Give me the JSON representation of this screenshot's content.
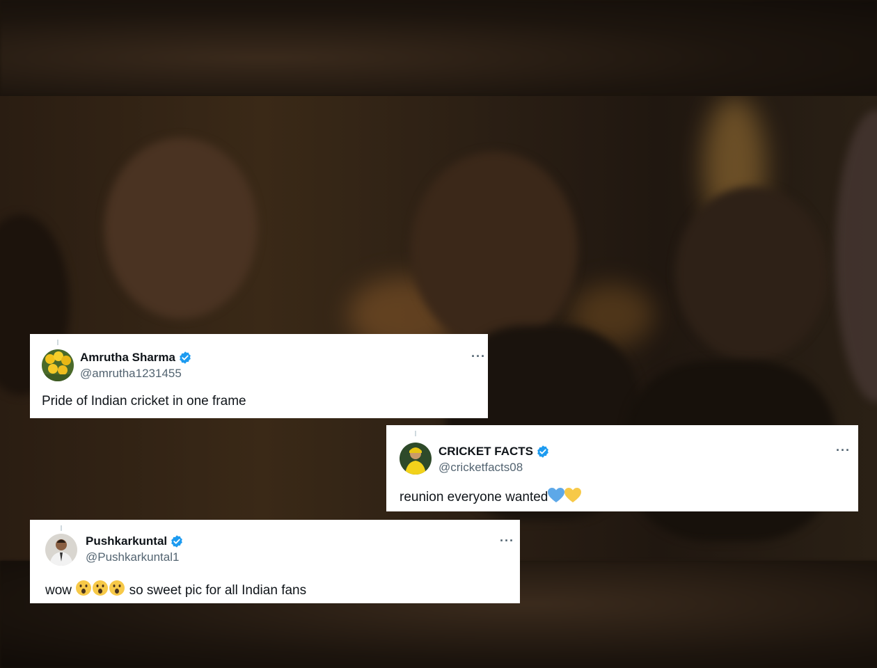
{
  "tweets": [
    {
      "name": "Amrutha Sharma",
      "handle": "@amrutha1231455",
      "text": "Pride of Indian cricket in one frame",
      "avatar_icon": "yellow-tulips-avatar",
      "more_label": "···"
    },
    {
      "name": "CRICKET FACTS",
      "handle": "@cricketfacts08",
      "text": "reunion everyone wanted",
      "emojis": [
        "💙",
        "💛"
      ],
      "avatar_icon": "cricketer-yellow-jersey-avatar",
      "more_label": "···"
    },
    {
      "name": "Pushkarkuntal",
      "handle": "@Pushkarkuntal1",
      "text_prefix": "wow",
      "emojis": [
        "😮",
        "😮",
        "😮"
      ],
      "text_suffix": "so sweet pic for all Indian fans",
      "avatar_icon": "man-portrait-avatar",
      "more_label": "···"
    }
  ],
  "colors": {
    "verified_badge": "#1d9bf0",
    "handle_text": "#536471",
    "background_photo": "#2a1d12"
  }
}
